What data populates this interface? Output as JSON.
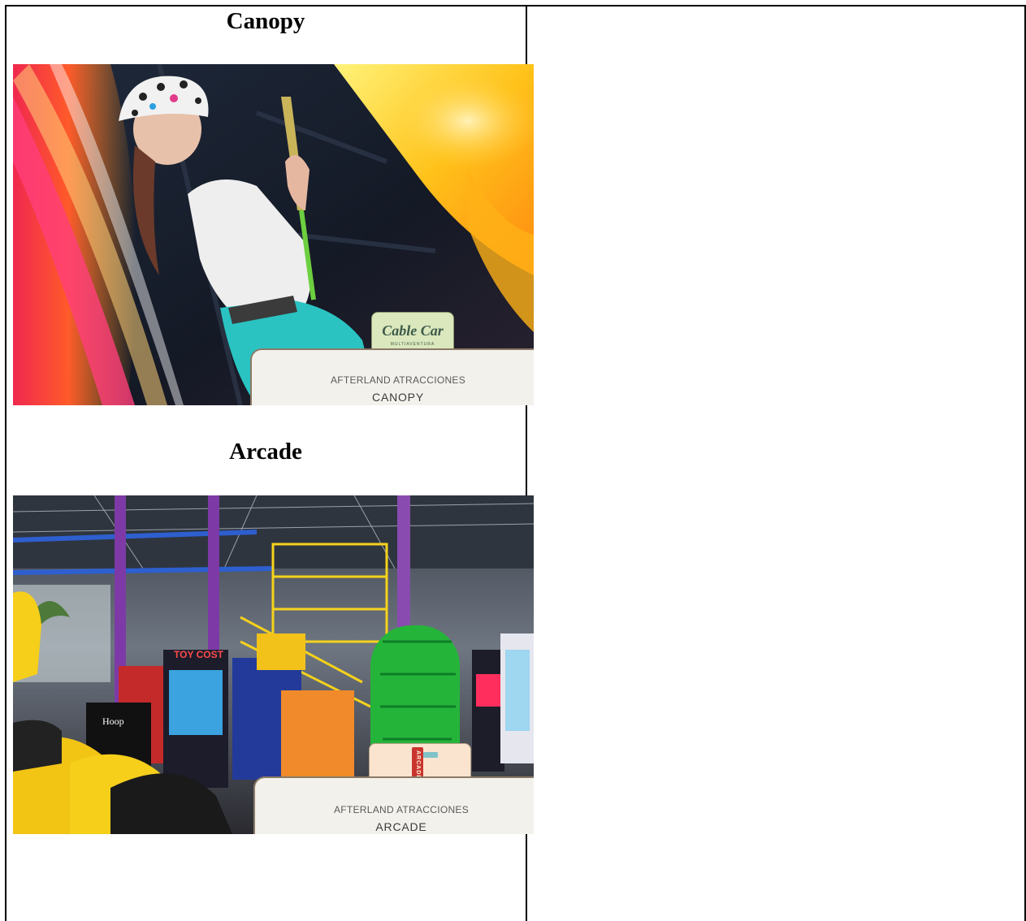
{
  "sections": [
    {
      "heading": "Canopy",
      "badge": {
        "logo": "Cable Car",
        "sub": "MULTIAVENTURA"
      },
      "caption": {
        "brand": "AFTERLAND ATRACCIONES",
        "title": "CANOPY"
      }
    },
    {
      "heading": "Arcade",
      "badge": {
        "logo": "ARCADE"
      },
      "caption": {
        "brand": "AFTERLAND ATRACCIONES",
        "title": "ARCADE"
      }
    }
  ],
  "colors": {
    "canopy_dark": "#161b26",
    "canopy_orange": "#ff7a1a",
    "canopy_yellow": "#ffd21e",
    "canopy_magenta": "#e4307a",
    "arcade_purple": "#7d3aa6",
    "arcade_yellow": "#f5d21b",
    "badge_green": "#dbe8bd",
    "badge_cream": "#fbe4cf",
    "plate_border": "#8a7a66"
  }
}
